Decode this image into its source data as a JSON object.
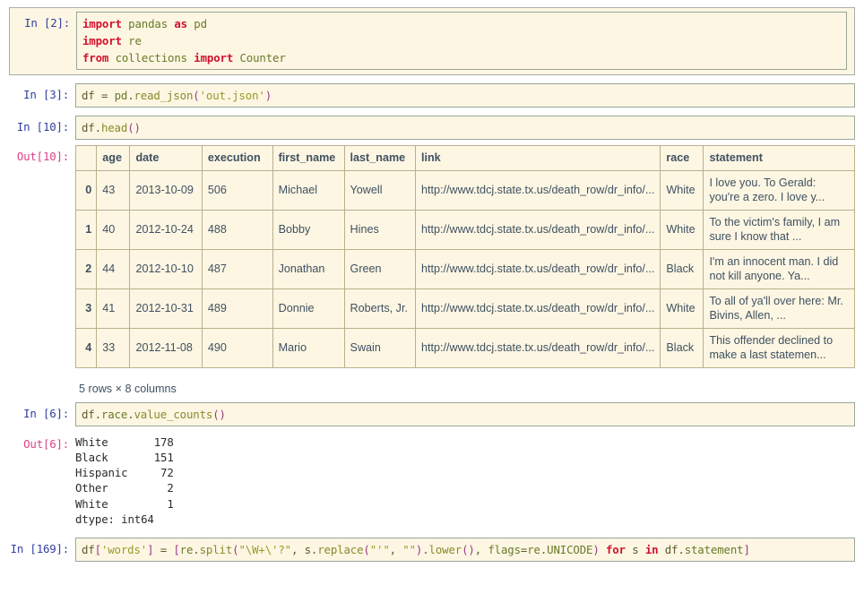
{
  "colors": {
    "prompt_in": "#303f9f",
    "prompt_out": "#d84388",
    "code_background": "#fdf6e3",
    "code_border": "#9aa79a",
    "keyword": "#d2122e",
    "string": "#9a9a28",
    "table_text": "#3f5161",
    "table_border": "#b9b08c",
    "page_background": "#ffffff"
  },
  "cells": [
    {
      "prompt": "In [2]:",
      "selected": true,
      "code_lines": [
        "import pandas as pd",
        "import re",
        "from collections import Counter"
      ]
    },
    {
      "prompt": "In [3]:",
      "selected": false,
      "code_lines": [
        "df = pd.read_json('out.json')"
      ]
    },
    {
      "prompt": "In [10]:",
      "selected": false,
      "code_lines": [
        "df.head()"
      ]
    },
    {
      "prompt": "Out[10]:",
      "selected": false,
      "output_type": "dataframe"
    },
    {
      "prompt": "In [6]:",
      "selected": false,
      "code_lines": [
        "df.race.value_counts()"
      ]
    },
    {
      "prompt": "Out[6]:",
      "selected": false,
      "output_type": "text"
    },
    {
      "prompt": "In [169]:",
      "selected": false,
      "code_lines": [
        "df['words'] = [re.split(\"\\W+\\'?\", s.replace(\"'\", \"\").lower(), flags=re.UNICODE) for s in df.statement]"
      ]
    }
  ],
  "prompts": {
    "in_2": "In [2]:",
    "in_3": "In [3]:",
    "in_10": "In [10]:",
    "out_10": "Out[10]:",
    "in_6": "In [6]:",
    "out_6": "Out[6]:",
    "in_169": "In [169]:"
  },
  "dataframe": {
    "columns": [
      "",
      "age",
      "date",
      "execution",
      "first_name",
      "last_name",
      "link",
      "race",
      "statement"
    ],
    "rows": [
      {
        "index": "0",
        "age": "43",
        "date": "2013-10-09",
        "execution": "506",
        "first_name": "Michael",
        "last_name": "Yowell",
        "link": "http://www.tdcj.state.tx.us/death_row/dr_info/...",
        "race": "White",
        "statement": "I love you. To Gerald: you're a zero. I love y..."
      },
      {
        "index": "1",
        "age": "40",
        "date": "2012-10-24",
        "execution": "488",
        "first_name": "Bobby",
        "last_name": "Hines",
        "link": "http://www.tdcj.state.tx.us/death_row/dr_info/...",
        "race": "White",
        "statement": "To the victim's family, I am sure I know that ..."
      },
      {
        "index": "2",
        "age": "44",
        "date": "2012-10-10",
        "execution": "487",
        "first_name": "Jonathan",
        "last_name": "Green",
        "link": "http://www.tdcj.state.tx.us/death_row/dr_info/...",
        "race": "Black",
        "statement": "I'm an innocent man. I did not kill anyone. Ya..."
      },
      {
        "index": "3",
        "age": "41",
        "date": "2012-10-31",
        "execution": "489",
        "first_name": "Donnie",
        "last_name": "Roberts, Jr.",
        "link": "http://www.tdcj.state.tx.us/death_row/dr_info/...",
        "race": "White",
        "statement": "To all of ya'll over here: Mr. Bivins, Allen, ..."
      },
      {
        "index": "4",
        "age": "33",
        "date": "2012-11-08",
        "execution": "490",
        "first_name": "Mario",
        "last_name": "Swain",
        "link": "http://www.tdcj.state.tx.us/death_row/dr_info/...",
        "race": "Black",
        "statement": "This offender declined to make a last statemen..."
      }
    ],
    "shape_label": "5 rows × 8 columns"
  },
  "value_counts_output": "White       178\nBlack       151\nHispanic     72\nOther         2\nWhite         1\ndtype: int64"
}
